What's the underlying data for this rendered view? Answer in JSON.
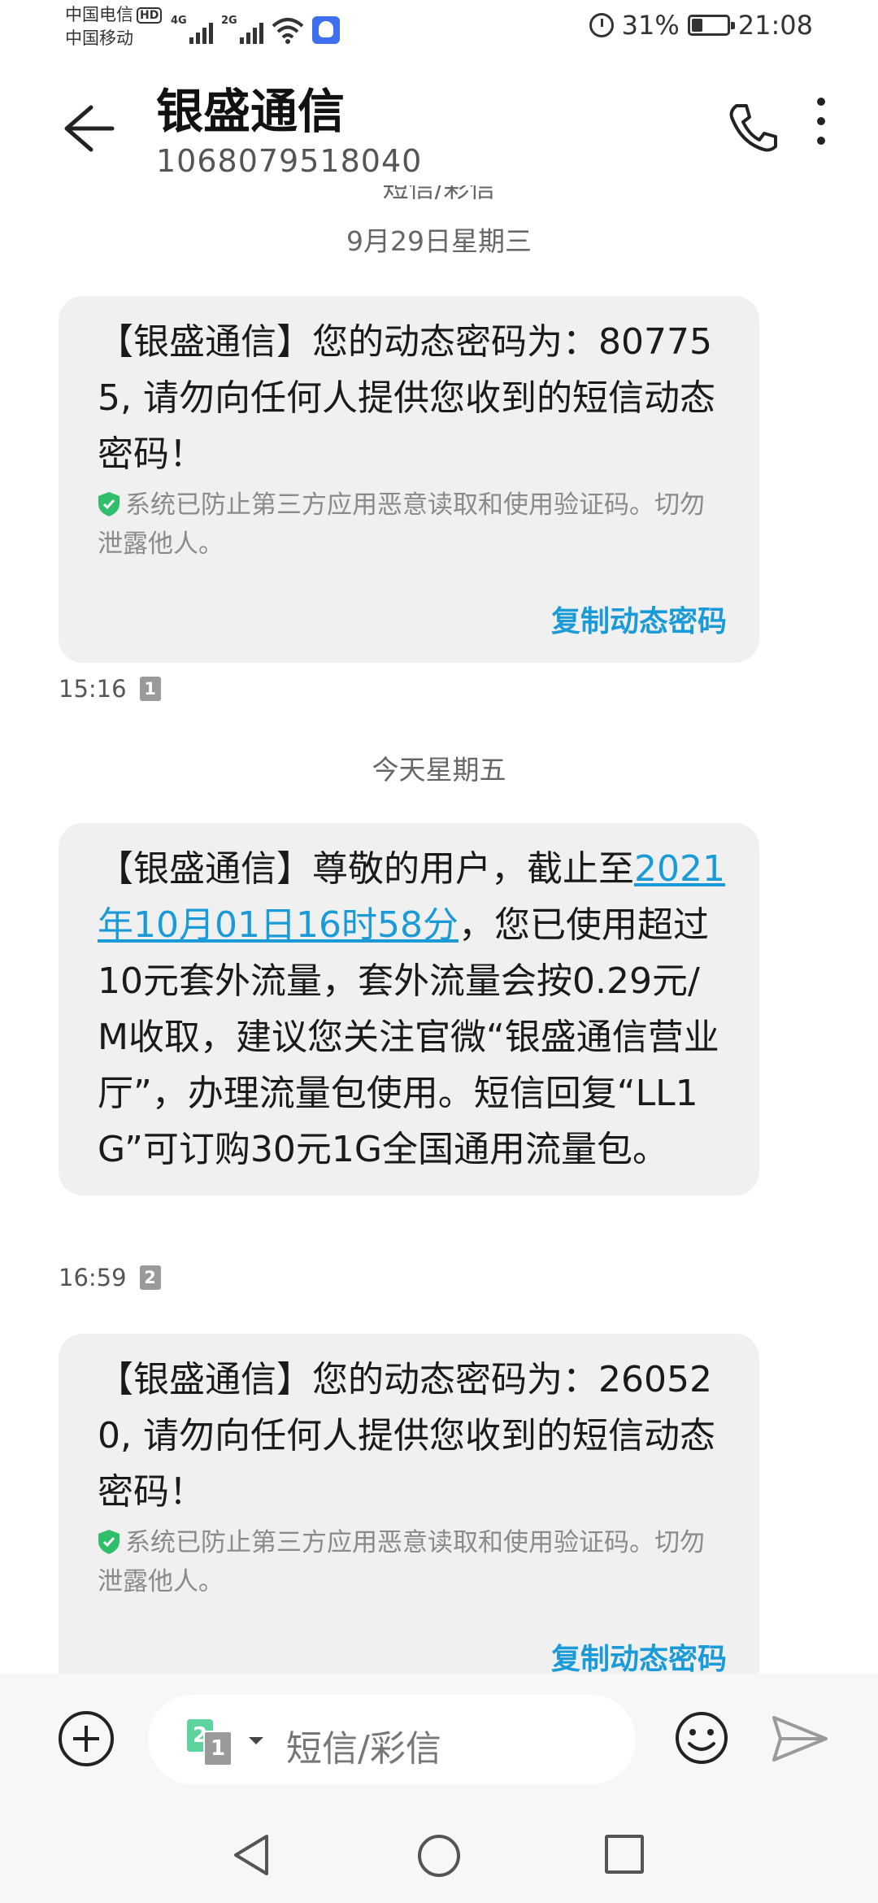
{
  "status_bar": {
    "carrier1": "中国电信",
    "carrier1_badge": "HD",
    "carrier2": "中国移动",
    "signal1_label": "4G",
    "signal2_label": "2G",
    "battery_percent": "31%",
    "battery_level": 0.31,
    "time": "21:08"
  },
  "header": {
    "title": "银盛通信",
    "number": "1068079518040"
  },
  "thread": {
    "cut_label": "短信/彩信",
    "date1": "9月29日星期三",
    "date2": "今天星期五",
    "messages": [
      {
        "text": "【银盛通信】您的动态密码为：807755, 请勿向任何人提供您收到的短信动态密码！",
        "notice": "系统已防止第三方应用恶意读取和使用验证码。切勿泄露他人。",
        "copy_label": "复制动态密码",
        "time": "15:16",
        "sim": "1"
      },
      {
        "text_prefix": "【银盛通信】尊敬的用户，截止至",
        "link": "2021年10月01日16时58分",
        "text_suffix": "，您已使用超过10元套外流量，套外流量会按0.29元/M收取，建议您关注官微“银盛通信营业厅”，办理流量包使用。短信回复“LL1G”可订购30元1G全国通用流量包。",
        "time": "16:59",
        "sim": "2"
      },
      {
        "text": "【银盛通信】您的动态密码为：260520, 请勿向任何人提供您收到的短信动态密码！",
        "notice": "系统已防止第三方应用恶意读取和使用验证码。切勿泄露他人。",
        "copy_label": "复制动态密码"
      }
    ]
  },
  "composer": {
    "sim_front": "2",
    "sim_back": "1",
    "placeholder": "短信/彩信"
  },
  "colors": {
    "link": "#1a9bd7",
    "bubble": "#f0f0f0",
    "shield": "#2fbf6a",
    "sim_green": "#5dd39e"
  }
}
